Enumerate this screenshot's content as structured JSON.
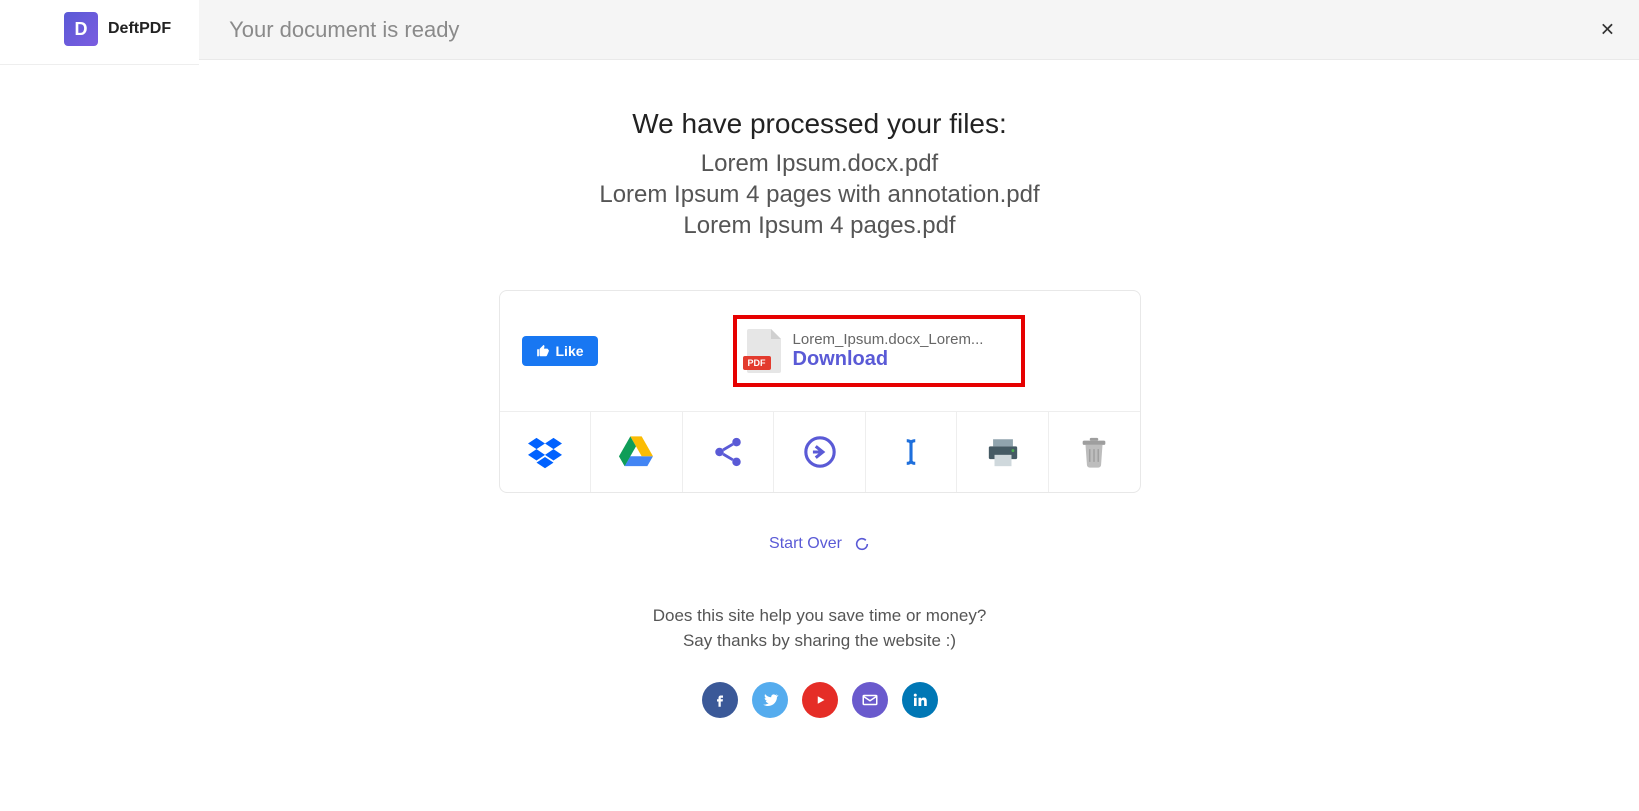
{
  "brand": {
    "logo_letter": "D",
    "name": "DeftPDF"
  },
  "header": {
    "title": "Your document is ready"
  },
  "processed": {
    "title": "We have processed your files:",
    "files": [
      "Lorem Ipsum.docx.pdf",
      "Lorem Ipsum 4 pages with annotation.pdf",
      "Lorem Ipsum 4 pages.pdf"
    ]
  },
  "like": {
    "label": "Like"
  },
  "download": {
    "badge": "PDF",
    "filename": "Lorem_Ipsum.docx_Lorem...",
    "label": "Download"
  },
  "actions": {
    "dropbox": "dropbox-icon",
    "gdrive": "google-drive-icon",
    "share": "share-icon",
    "export": "arrow-circle-icon",
    "rename": "text-cursor-icon",
    "print": "printer-icon",
    "delete": "trash-icon"
  },
  "start_over": "Start Over",
  "thanks": {
    "line1": "Does this site help you save time or money?",
    "line2": "Say thanks by sharing the website :)"
  }
}
